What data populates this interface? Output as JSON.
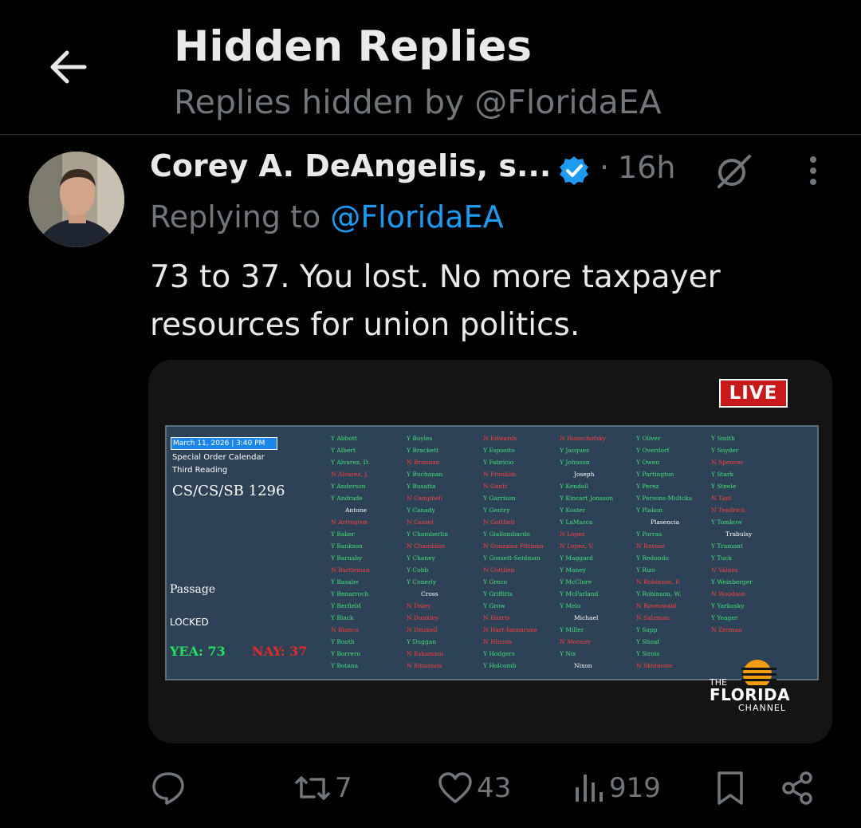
{
  "header": {
    "title": "Hidden Replies",
    "subtitle": "Replies hidden by @FloridaEA"
  },
  "tweet": {
    "author_name": "Corey A. DeAngelis, s...",
    "time": "16h",
    "dot": "·",
    "replying_prefix": "Replying to ",
    "replying_handle": "@FloridaEA",
    "text": "73 to 37. You lost. No more taxpayer resources for union politics."
  },
  "media": {
    "live_label": "LIVE",
    "date_time": "March 11, 2026 | 3:40 PM",
    "calendar": "Special Order Calendar",
    "reading": "Third Reading",
    "bill": "CS/CS/SB 1296",
    "passage": "Passage",
    "locked": "LOCKED",
    "yea": "YEA: 73",
    "nay": "NAY: 37",
    "logo_the": "THE",
    "logo_main": "FLORIDA",
    "logo_sub": "CHANNEL",
    "columns": [
      [
        "Y Abbott",
        "Y Albert",
        "Y Alvarez, D.",
        "N Alvarez, J.",
        "Y Anderson",
        "Y Andrade",
        "Antone",
        "N Arrington",
        "Y Baker",
        "Y Bankson",
        "Y Barnaby",
        "N Bartleman",
        "Y Basabe",
        "Y Benarroch",
        "Y Berfield",
        "Y Black",
        "N Blanco",
        "Y Booth",
        "Y Borrero",
        "Y Botana"
      ],
      [
        "Y Boyles",
        "Y Brackett",
        "N Brannan",
        "Y Buchanan",
        "Y Busatta",
        "N Campbell",
        "Y Canady",
        "N Cassel",
        "Y Chamberlin",
        "N Chambliss",
        "Y Chaney",
        "Y Cobb",
        "Y Conerly",
        "Cross",
        "N Daley",
        "N Dunkley",
        "N Driskell",
        "Y Duggan",
        "N Eskamani",
        "N Edmonds"
      ],
      [
        "N Edwards",
        "Y Esposito",
        "Y Fabricio",
        "N Franklin",
        "N Gantt",
        "Y Garrison",
        "Y Gentry",
        "N Gottlieb",
        "Y Giallombardo",
        "N Gonzalez Pittman",
        "Y Gossett-Seidman",
        "N Gottlieb",
        "Y Greco",
        "Y Griffitts",
        "Y Grow",
        "N Harris",
        "N Hart-Iannarone",
        "N Hinson",
        "Y Hodgers",
        "Y Holcomb"
      ],
      [
        "N Hunschofsky",
        "Y Jacques",
        "Y Johnson",
        "Joseph",
        "Y Kendall",
        "Y Kincart Jonsson",
        "Y Koster",
        "Y LaMarca",
        "N Lopez",
        "N Lopez, V.",
        "Y Maggard",
        "Y Maney",
        "Y McClure",
        "Y McFarland",
        "Y Melo",
        "Michael",
        "Y Miller",
        "N Mooney",
        "Y Nix",
        "Nixon"
      ],
      [
        "Y Oliver",
        "Y Overdorf",
        "Y Owen",
        "Y Partington",
        "Y Perez",
        "Y Persons-Mulicka",
        "Y Plakon",
        "Plasencia",
        "Y Porras",
        "N Rayner",
        "Y Redondo",
        "Y Rizo",
        "N Robinson, F.",
        "Y Robinson, W.",
        "N Rosenwald",
        "N Salzman",
        "Y Sapp",
        "Y Shoaf",
        "Y Sirois",
        "N Skidmore"
      ],
      [
        "Y Smith",
        "Y Snyder",
        "N Spencer",
        "Y Stark",
        "Y Steele",
        "N Tant",
        "N Tendrich",
        "Y Tomkow",
        "Trabulsy",
        "Y Tramont",
        "Y Tuck",
        "N Valdes",
        "Y Weinberger",
        "N Woodson",
        "Y Yarkosky",
        "Y Yeager",
        "N Zerman"
      ]
    ]
  },
  "actions": {
    "reply_count": "",
    "retweet_count": "7",
    "like_count": "43",
    "views_count": "919"
  },
  "colors": {
    "background": "#000000",
    "text": "#e7e9ea",
    "secondary": "#71767b",
    "accent": "#1d9bf0",
    "live_red": "#c8191b"
  },
  "icons": [
    "back-arrow-icon",
    "verified-badge-icon",
    "grok-icon",
    "more-icon",
    "reply-icon",
    "retweet-icon",
    "like-icon",
    "views-icon",
    "bookmark-icon",
    "share-icon"
  ]
}
